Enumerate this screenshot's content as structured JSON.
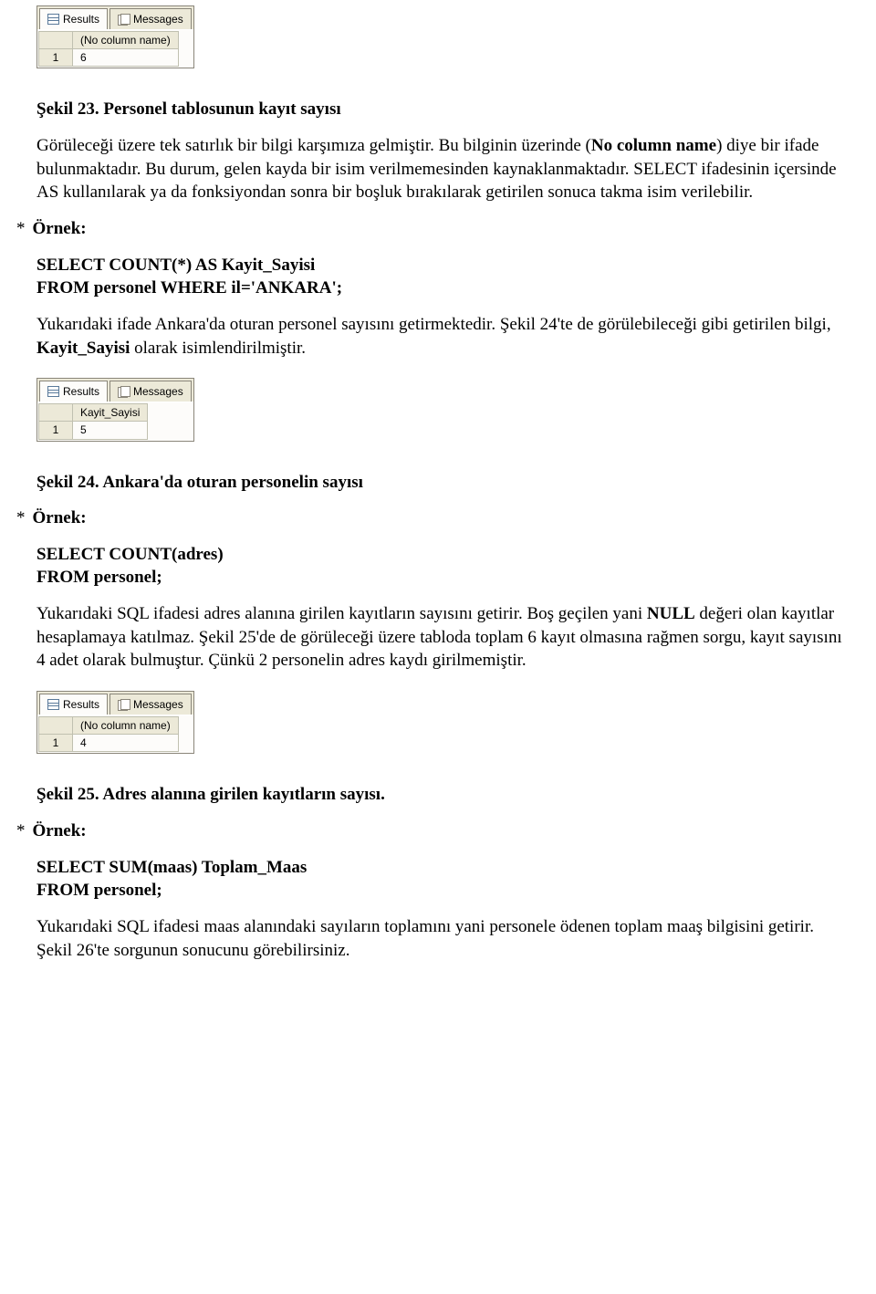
{
  "panels": {
    "results_tab": "Results",
    "messages_tab": "Messages",
    "p1": {
      "header": "(No column name)",
      "rownum": "1",
      "value": "6"
    },
    "p2": {
      "header": "Kayit_Sayisi",
      "rownum": "1",
      "value": "5"
    },
    "p3": {
      "header": "(No column name)",
      "rownum": "1",
      "value": "4"
    }
  },
  "captions": {
    "s23": "Şekil 23. Personel tablosunun kayıt sayısı",
    "s24": "Şekil 24. Ankara'da oturan personelin sayısı",
    "s25": "Şekil 25. Adres alanına girilen kayıtların sayısı."
  },
  "paras": {
    "a1a": "Görüleceği üzere tek satırlık bir bilgi karşımıza gelmiştir. Bu bilginin üzerinde (",
    "a1b": "No column name",
    "a1c": ") diye bir ifade bulunmaktadır. Bu durum,  gelen kayda bir isim verilmemesinden kaynaklanmaktadır. SELECT ifadesinin içersinde AS kullanılarak ya da fonksiyondan sonra bir boşluk bırakılarak getirilen sonuca takma isim verilebilir.",
    "b1a": "Yukarıdaki ifade Ankara'da oturan personel sayısını getirmektedir. Şekil 24'te de görülebileceği gibi getirilen bilgi, ",
    "b1b": "Kayit_Sayisi",
    "b1c": " olarak isimlendirilmiştir.",
    "c1a": "Yukarıdaki SQL ifadesi adres alanına girilen kayıtların sayısını getirir. Boş geçilen yani ",
    "c1b": "NULL",
    "c1c": " değeri olan kayıtlar hesaplamaya katılmaz. Şekil 25'de de görüleceği üzere tabloda toplam 6 kayıt olmasına rağmen sorgu, kayıt sayısını 4 adet olarak bulmuştur. Çünkü 2 personelin adres kaydı girilmemiştir.",
    "d1": "Yukarıdaki SQL ifadesi maas alanındaki sayıların toplamını yani personele ödenen toplam maaş bilgisini getirir. Şekil 26'te sorgunun sonucunu görebilirsiniz."
  },
  "labels": {
    "ornek": "Örnek:",
    "ast": "*"
  },
  "sql": {
    "q1": "SELECT COUNT(*) AS Kayit_Sayisi\nFROM personel WHERE il='ANKARA';",
    "q2": "SELECT COUNT(adres)\nFROM personel;",
    "q3": "SELECT SUM(maas) Toplam_Maas\nFROM personel;"
  }
}
